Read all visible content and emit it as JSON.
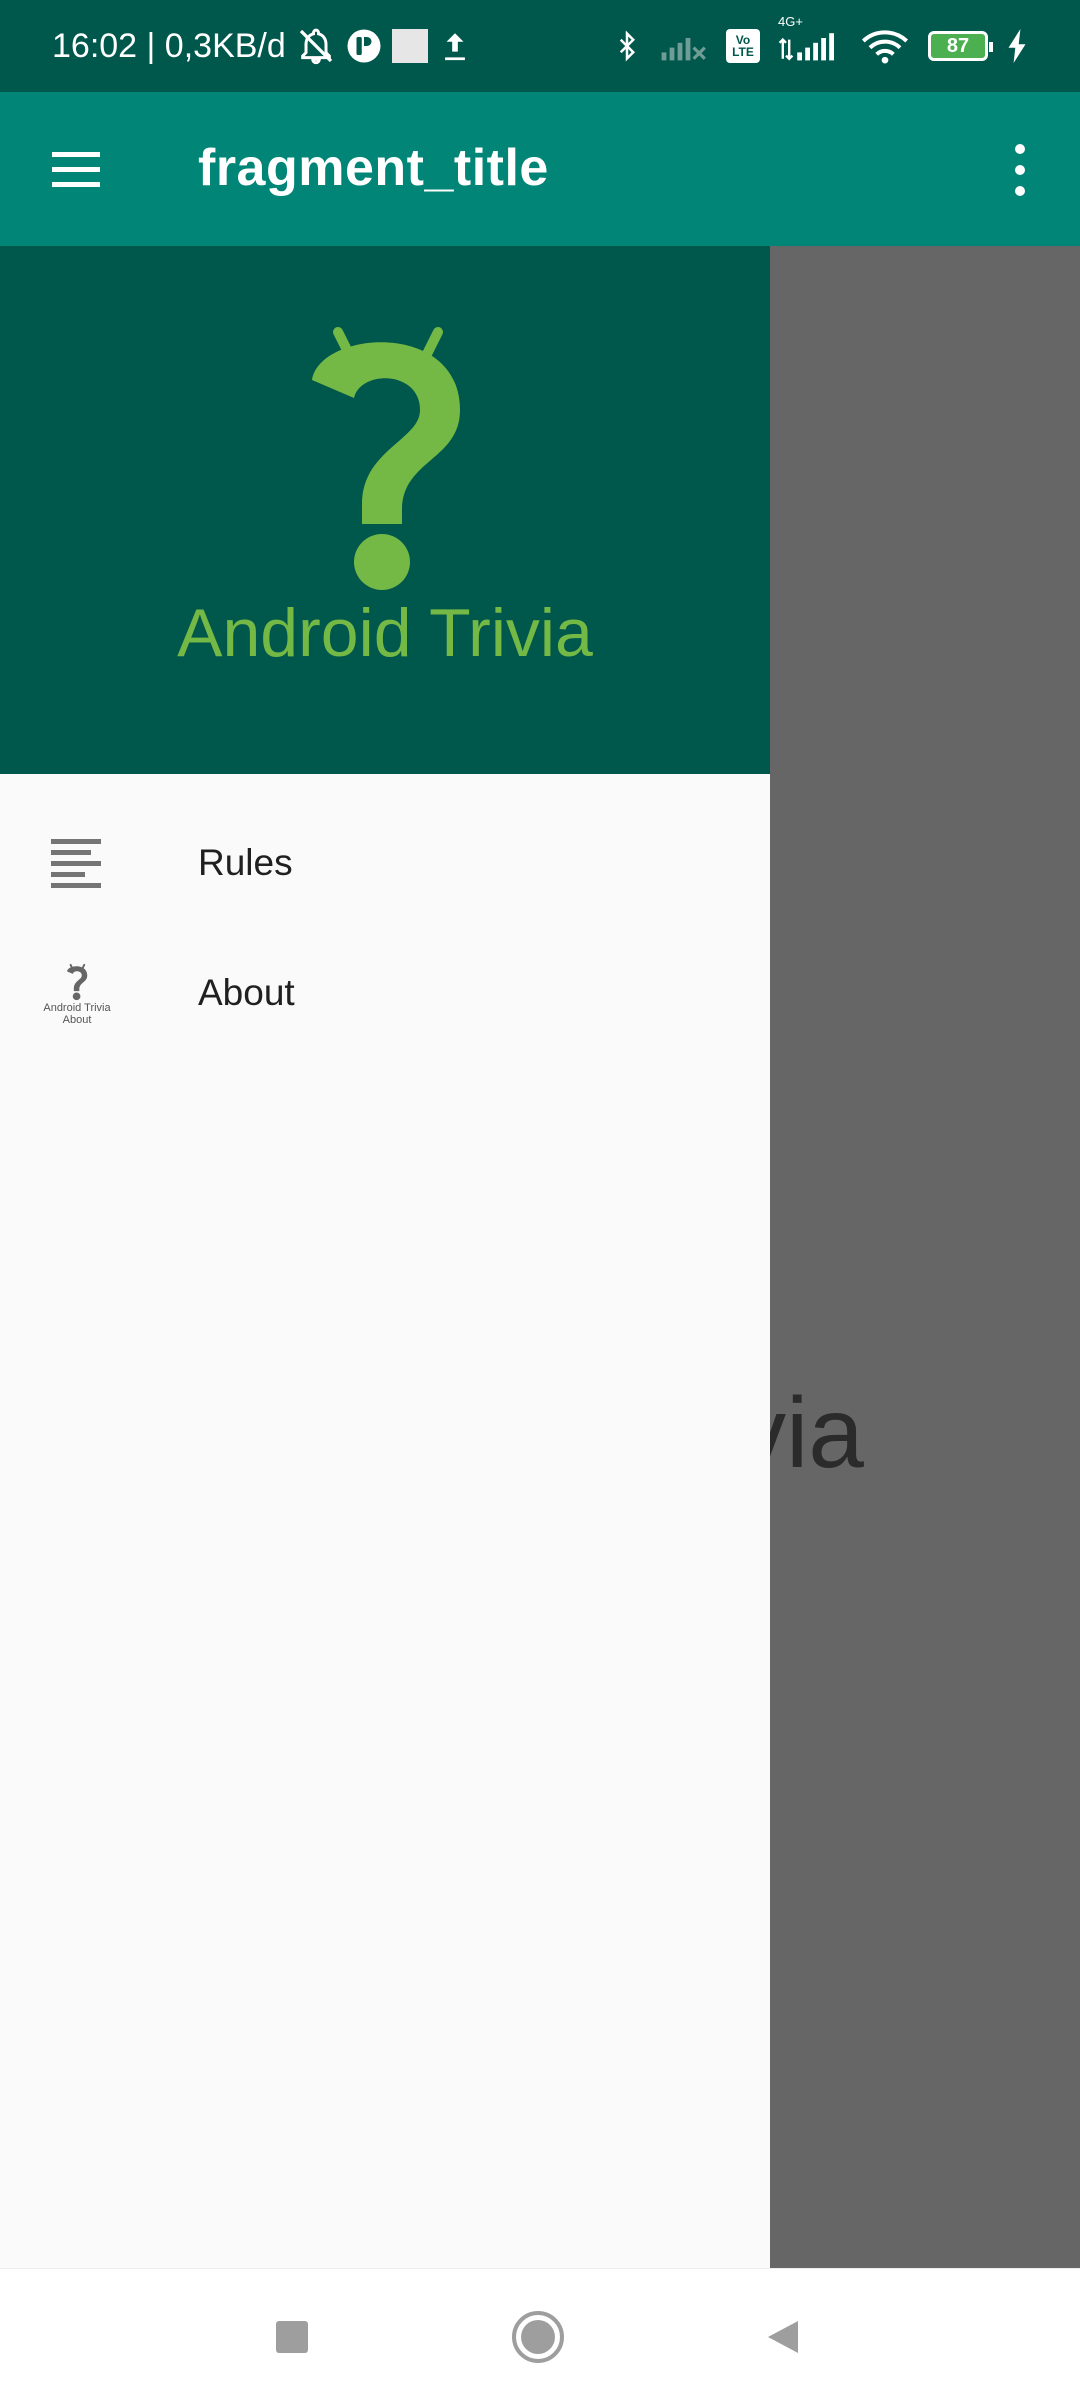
{
  "status_bar": {
    "time_text": "16:02 | 0,3KB/d",
    "battery_level": "87",
    "icons": [
      "bell-off-icon",
      "app-notification-icon",
      "square-icon",
      "upload-icon",
      "bluetooth-icon",
      "signal-no-sim-icon",
      "volte-icon",
      "signal-4g-icon",
      "wifi-icon",
      "battery-icon",
      "charging-icon"
    ],
    "network_label_volte_top": "Vo",
    "network_label_volte_bottom": "LTE",
    "network_label_4g": "4G+"
  },
  "app_bar": {
    "title": "fragment_title",
    "background_color": "#008577"
  },
  "drawer": {
    "header_color": "#00574b",
    "brand_text": "Android Trivia",
    "brand_color": "#74b845",
    "items": [
      {
        "label": "Rules",
        "icon": "rules-list-icon"
      },
      {
        "label": "About",
        "icon": "android-trivia-about-icon",
        "icon_caption_1": "Android Trivia",
        "icon_caption_2": "About"
      }
    ]
  },
  "underlay": {
    "visible_text": "via"
  },
  "navigation_bar": {
    "buttons": [
      "recents-button",
      "home-button",
      "back-button"
    ]
  }
}
